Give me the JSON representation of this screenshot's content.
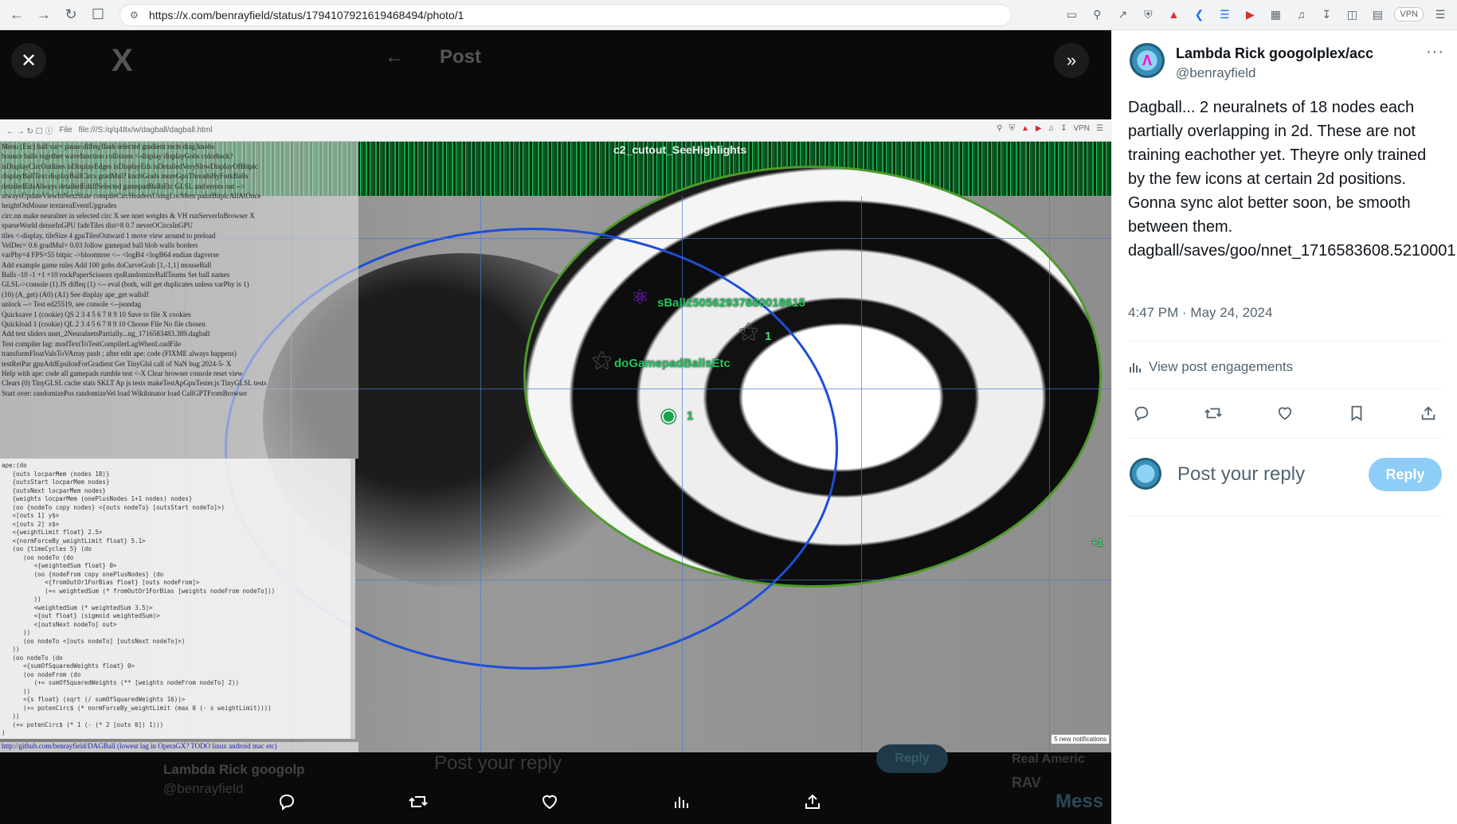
{
  "browser": {
    "url": "https://x.com/benrayfield/status/1794107921619468494/photo/1",
    "vpn_label": "VPN"
  },
  "viewer": {
    "bg_title": "Post",
    "inner_url": "file:///S:/q/q48x/w/dagball/dagball.html",
    "inner_file_label": "File",
    "top_strip_label": "c2_cutout_SeeHighlights",
    "ball_labels": {
      "ball1": "sBall2505629378800186​15",
      "ball2": "doGamepadBallsEtc",
      "ball3": "1",
      "ball4": "1",
      "ball5": "+1"
    },
    "notification": "5 new notifications",
    "link_line": "http://github.com/benrayfield/DAGBall (lowest lag in OperaGX? TODO linux android mac etc)",
    "bg_author": "Lambda Rick googolp",
    "bg_handle": "@benrayfield",
    "bg_reply_placeholder": "Post your reply",
    "bg_reply_button": "Reply",
    "bg_real": "Real Americ",
    "bg_rav": "RAV",
    "bg_messages": "Mess"
  },
  "control_lines": [
    "Menu (Esc)  ball  var+  pause  diffeq  flash selected  gradient rects  drag knobs",
    "bounce balls together  wavefunction collisions  <-display  displayGobs  colorback?",
    "isDisplayCircOutlines  isDisplayEdges  isDisplayEds  isDetailedVerySlowDisplayOfBitpic",
    "displayBallText  displayBallCircs  gradMul?  knobGrads  moreGpuThreadsByForkBalls",
    "detailedEdsAlways  detailedEdsIfSelected  gamepadBallsEtc  GLSL and errors out -->",
    "alwaysUpdateViewInNextState  compileCircHeadersUsingLocMem  paintBitpicAllAtOnce",
    "heightOnMouse  textareaEventUpgrades",
    "circ.nn  make neuralnet in selected circ  X  see nnet weights & VH  runServerInBrowser  X",
    "sparseWorld  denseInGPU  fadeTiles dist=8  0.7  neverOCircsInGPU",
    "tiles  <-display, tileSize 4  gpuTilesOutward 1  move view around to preload",
    "VelDec= 0.6  gradMul= 0.03  follow gamepad ball  blob walls  borders",
    "varPhy=4  FPS=55  bitpic  ->bloomtree  <--  <logB4  <logB64  endian  dagverse",
    "Add example game rules  Add 100 gobs  doCurveGrab  [1,-1,1]  mouseBall",
    "Balls -10 -1 +1 +10  rockPaperScissors  rpsRandomizeBallTeams  Set ball names",
    "GLSL->console (1)  JS diffeq (1)  <-- eval  (both, will get duplicates unless varPhy is 1)",
    "(10)  (A_get)  (A0)  (A1)  See display ape_get  wallsIf",
    "unlock -->  Test ed25519, see console  <--jsondag",
    "Quicksave 1 (cookie)  QS 2 3 4 5 6 7 8 9 10  Save to file  X cookies",
    "Quickload 1 (cookie)  QL 2 3 4 5 6 7 8 9 10  Choose File  No file chosen",
    "Add test sliders  nnet_2NeuralnetsPartially...ng_1716583483.389.dagball",
    "Test compiler lag:  modTextToTestCompilerLagWhenLoadFile",
    "transformFloatValsToVArray  push ; after edit ape: code (FIXME always happens)",
    "testRetPar  gpuAddEpsilonForGradient  Get TinyGlsl call of NaN bug 2024-5-  X",
    "Help with ape: code  all gamepads rumble test  <-X  Clear browser console  reset view",
    "Clears (0) TinyGLSL cache  stats  SKLT  Ap js tests  makeTestApGpuTester.js  TinyGLSL tests",
    "Start over:  randomizePos  randomizeVel  load Wikibinator  load CallGPTFromBrowser"
  ],
  "code_text": "ape:(do\n   {outs locparMem (nodes 18)}\n   {outsStart locparMem nodes}\n   {outsNext locparMem nodes}\n   {weights locparMem (onePlusNodes 1+1 nodes) nodes}\n   (oo {nodeTo copy nodes} <{outs nodeTo} [outsStart nodeTo]>)\n   <[outs 1] y$>\n   <[outs 2] x$>\n   <{weightLimit float} 2.5>\n   <{normForceBy_weightLimit float} 5.1>\n   (oo {timeCycles 5} (do\n      (oo nodeTo (do\n         <{weightedSum float} 0>\n         (oo {nodeFrom copy onePlusNodes} (do\n            <{fromOutOr1ForBias float} [outs nodeFrom]>\n            (+= weightedSum (* fromOutOr1ForBias [weights nodeFrom nodeTo]))\n         ))\n         <weightedSum (* weightedSum 3.5)>\n         <{out float} (sigmoid weightedSum)>\n         <[outsNext nodeTo] out>\n      ))\n      (oo nodeTo <[outs nodeTo] [outsNext nodeTo]>)\n   ))\n   (oo nodeTo (do\n      <{sumOfSquaredWeights float} 0>\n      (oo nodeFrom (do\n         (+= sumOfSquaredWeights (** [weights nodeFrom nodeTo] 2))\n      ))\n      <{s float} (sqrt (/ sumOfSquaredWeights 16))>\n      (+= potenCirc$ (* normForceBy_weightLimit (max 0 (- s weightLimit))))\n   ))\n   (+= potenCirc$ (* 1 (- (* 2 [outs 0]) 1)))\n)",
  "tweet": {
    "author_name": "Lambda Rick googolplex/acc",
    "author_handle": "@benrayfield",
    "text": "Dagball... 2 neuralnets of 18 nodes each partially overlapping in 2d. These are not training eachother yet. Theyre only trained by the few icons at certain 2d positions. Gonna sync alot better soon, be smooth between them. dagball/saves/goo/nnet_1716583608.5210001.dagball",
    "time": "4:47 PM · May 24, 2024",
    "engagements": "View post engagements",
    "reply_placeholder": "Post your reply",
    "reply_button": "Reply"
  },
  "colors": {
    "reply_button_bg": "#8ecdf8",
    "circle_blue": "#1d4ed8",
    "circle_green": "#4d9b2a",
    "strip_green": "#22c55e"
  }
}
